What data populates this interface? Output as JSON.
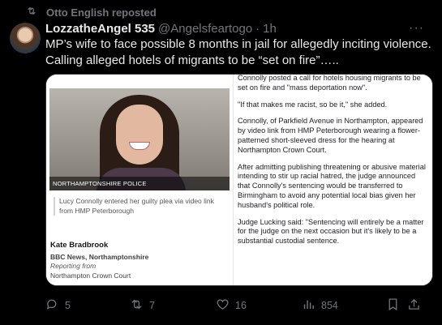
{
  "repost": {
    "text": "Otto English reposted",
    "icon": "repost-icon"
  },
  "tweet": {
    "display_name": "LozzatheAngel 535",
    "handle": "@Angelsfeartogo",
    "separator": "·",
    "time": "1h",
    "more": "···",
    "text": "MP’s wife to face possible 8 months in jail for allegedly inciting violence. Calling alleged hotels of migrants to be “set on fire”….."
  },
  "article": {
    "photo_credit": "NORTHAMPTONSHIRE POLICE",
    "caption": "Lucy Connolly entered her guilty plea via video link from HMP Peterborough",
    "author_name": "Kate Bradbrook",
    "author_org": "BBC News, Northamptonshire",
    "reporting_label": "Reporting from",
    "reporting_location": "Northampton Crown Court",
    "paragraphs": [
      "Connolly posted a call for hotels housing migrants to be set on fire and \"mass deportation now\".",
      "\"If that makes me racist, so be it,\" she added.",
      "Connolly, of Parkfield Avenue in Northampton, appeared by video link from HMP Peterborough wearing a flower-patterned short-sleeved dress for the hearing at Northampton Crown Court.",
      "After admitting publishing threatening or abusive material intending to stir up racial hatred, the judge announced that Connolly's sentencing would be transferred to Birmingham to avoid any potential local bias given her husband's political role.",
      "Judge Lucking said: \"Sentencing will entirely be a matter for the judge on the next occasion but it's likely to be a substantial custodial sentence."
    ]
  },
  "actions": {
    "replies": "5",
    "reposts": "7",
    "likes": "16",
    "views": "854"
  },
  "colors": {
    "background": "#000000",
    "text": "#e7e9ea",
    "muted": "#71767b",
    "border": "#2f3336",
    "repost_active": "#71767b"
  }
}
